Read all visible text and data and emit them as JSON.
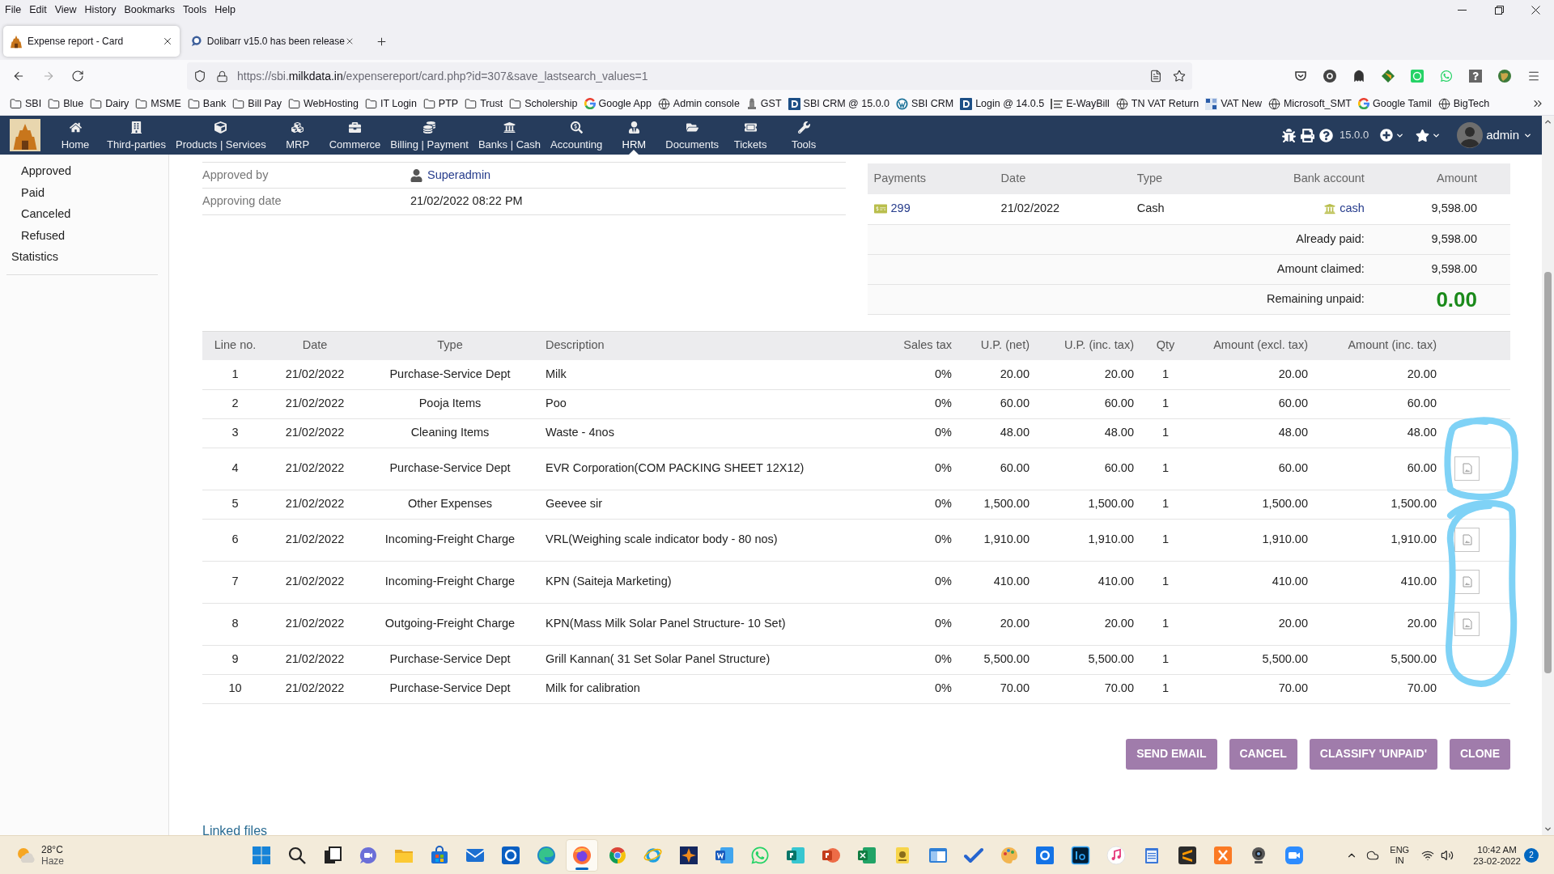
{
  "menubar": [
    "File",
    "Edit",
    "View",
    "History",
    "Bookmarks",
    "Tools",
    "Help"
  ],
  "tabs": [
    {
      "title": "Expense report - Card",
      "selected": true
    },
    {
      "title": "Dolibarr v15.0 has been release",
      "selected": false
    }
  ],
  "address_bar": {
    "url_start": "https://sbi.",
    "url_domain": "milkdata.in",
    "url_rest": "/expensereport/card.php?id=307&save_lastsearch_values=1"
  },
  "bookmarks": [
    {
      "label": "SBI",
      "kind": "folder"
    },
    {
      "label": "Blue",
      "kind": "folder"
    },
    {
      "label": "Dairy",
      "kind": "folder"
    },
    {
      "label": "MSME",
      "kind": "folder"
    },
    {
      "label": "Bank",
      "kind": "folder"
    },
    {
      "label": "Bill Pay",
      "kind": "folder"
    },
    {
      "label": "WebHosting",
      "kind": "folder"
    },
    {
      "label": "IT Login",
      "kind": "folder"
    },
    {
      "label": "PTP",
      "kind": "folder"
    },
    {
      "label": "Trust",
      "kind": "folder"
    },
    {
      "label": "Scholership",
      "kind": "folder"
    },
    {
      "label": "Google App",
      "kind": "google"
    },
    {
      "label": "Admin console",
      "kind": "globe"
    },
    {
      "label": "GST",
      "kind": "emblem"
    },
    {
      "label": "SBI CRM @ 15.0.0",
      "kind": "dolibarr"
    },
    {
      "label": "SBI CRM",
      "kind": "wordpress"
    },
    {
      "label": "Login @ 14.0.5",
      "kind": "dolibarr"
    },
    {
      "label": "E-WayBill",
      "kind": "lines"
    },
    {
      "label": "TN VAT Return",
      "kind": "globe"
    },
    {
      "label": "VAT New",
      "kind": "tile"
    },
    {
      "label": "Microsoft_SMT",
      "kind": "globe"
    },
    {
      "label": "Google Tamil",
      "kind": "google"
    },
    {
      "label": "BigTech",
      "kind": "globe"
    }
  ],
  "top_menu": {
    "items": [
      {
        "label": "Home",
        "kind": "home",
        "selected": false
      },
      {
        "label": "Third-parties",
        "kind": "companies",
        "selected": false
      },
      {
        "label": "Products | Services",
        "kind": "products",
        "selected": false
      },
      {
        "label": "MRP",
        "kind": "mrp",
        "selected": false
      },
      {
        "label": "Commerce",
        "kind": "commerce",
        "selected": false
      },
      {
        "label": "Billing | Payment",
        "kind": "billing",
        "selected": false
      },
      {
        "label": "Banks | Cash",
        "kind": "bank",
        "selected": false
      },
      {
        "label": "Accounting",
        "kind": "accounting",
        "selected": false
      },
      {
        "label": "HRM",
        "kind": "hrm",
        "selected": true
      },
      {
        "label": "Documents",
        "kind": "documents",
        "selected": false
      },
      {
        "label": "Tickets",
        "kind": "tickets",
        "selected": false
      },
      {
        "label": "Tools",
        "kind": "tools",
        "selected": false
      }
    ],
    "version": "15.0.0",
    "user": "admin"
  },
  "sidebar": {
    "status_filters": [
      "Approved",
      "Paid",
      "Canceled",
      "Refused"
    ],
    "statistics": "Statistics"
  },
  "approval": [
    {
      "label": "Approved by",
      "value": "Superadmin",
      "kind": "user"
    },
    {
      "label": "Approving date",
      "value": "21/02/2022 08:22 PM",
      "kind": "text"
    }
  ],
  "payments": {
    "columns": [
      "Payments",
      "Date",
      "Type",
      "Bank account",
      "Amount"
    ],
    "rows": [
      {
        "ref": "299",
        "date": "21/02/2022",
        "type": "Cash",
        "bank_account": "cash",
        "amount": "9,598.00"
      }
    ],
    "totals": [
      {
        "label": "Already paid:",
        "value": "9,598.00",
        "kind": "normal"
      },
      {
        "label": "Amount claimed:",
        "value": "9,598.00",
        "kind": "normal"
      },
      {
        "label": "Remaining unpaid:",
        "value": "0.00",
        "kind": "remaining"
      }
    ]
  },
  "lines": {
    "columns": [
      "Line no.",
      "Date",
      "Type",
      "Description",
      "Sales tax",
      "U.P. (net)",
      "U.P. (inc. tax)",
      "Qty",
      "Amount (excl. tax)",
      "Amount (inc. tax)"
    ],
    "rows": [
      {
        "line_no": "1",
        "date": "21/02/2022",
        "type": "Purchase-Service Dept",
        "description": "Milk",
        "sales_tax": "0%",
        "up_net": "20.00",
        "up_inc_tax": "20.00",
        "qty": "1",
        "amount_excl_tax": "20.00",
        "amount_inc_tax": "20.00",
        "attachment": false
      },
      {
        "line_no": "2",
        "date": "21/02/2022",
        "type": "Pooja Items",
        "description": "Poo",
        "sales_tax": "0%",
        "up_net": "60.00",
        "up_inc_tax": "60.00",
        "qty": "1",
        "amount_excl_tax": "60.00",
        "amount_inc_tax": "60.00",
        "attachment": false
      },
      {
        "line_no": "3",
        "date": "21/02/2022",
        "type": "Cleaning Items",
        "description": "Waste - 4nos",
        "sales_tax": "0%",
        "up_net": "48.00",
        "up_inc_tax": "48.00",
        "qty": "1",
        "amount_excl_tax": "48.00",
        "amount_inc_tax": "48.00",
        "attachment": false
      },
      {
        "line_no": "4",
        "date": "21/02/2022",
        "type": "Purchase-Service Dept",
        "description": "EVR Corporation(COM PACKING SHEET 12X12)",
        "sales_tax": "0%",
        "up_net": "60.00",
        "up_inc_tax": "60.00",
        "qty": "1",
        "amount_excl_tax": "60.00",
        "amount_inc_tax": "60.00",
        "attachment": true
      },
      {
        "line_no": "5",
        "date": "21/02/2022",
        "type": "Other Expenses",
        "description": "Geevee sir",
        "sales_tax": "0%",
        "up_net": "1,500.00",
        "up_inc_tax": "1,500.00",
        "qty": "1",
        "amount_excl_tax": "1,500.00",
        "amount_inc_tax": "1,500.00",
        "attachment": false
      },
      {
        "line_no": "6",
        "date": "21/02/2022",
        "type": "Incoming-Freight Charge",
        "description": "VRL(Weighing scale indicator body - 80 nos)",
        "sales_tax": "0%",
        "up_net": "1,910.00",
        "up_inc_tax": "1,910.00",
        "qty": "1",
        "amount_excl_tax": "1,910.00",
        "amount_inc_tax": "1,910.00",
        "attachment": true
      },
      {
        "line_no": "7",
        "date": "21/02/2022",
        "type": "Incoming-Freight Charge",
        "description": "KPN (Saiteja Marketing)",
        "sales_tax": "0%",
        "up_net": "410.00",
        "up_inc_tax": "410.00",
        "qty": "1",
        "amount_excl_tax": "410.00",
        "amount_inc_tax": "410.00",
        "attachment": true
      },
      {
        "line_no": "8",
        "date": "21/02/2022",
        "type": "Outgoing-Freight Charge",
        "description": "KPN(Mass Milk Solar Panel Structure- 10 Set)",
        "sales_tax": "0%",
        "up_net": "20.00",
        "up_inc_tax": "20.00",
        "qty": "1",
        "amount_excl_tax": "20.00",
        "amount_inc_tax": "20.00",
        "attachment": true
      },
      {
        "line_no": "9",
        "date": "21/02/2022",
        "type": "Purchase-Service Dept",
        "description": "Grill Kannan( 31 Set Solar Panel Structure)",
        "sales_tax": "0%",
        "up_net": "5,500.00",
        "up_inc_tax": "5,500.00",
        "qty": "1",
        "amount_excl_tax": "5,500.00",
        "amount_inc_tax": "5,500.00",
        "attachment": false
      },
      {
        "line_no": "10",
        "date": "21/02/2022",
        "type": "Purchase-Service Dept",
        "description": "Milk for calibration",
        "sales_tax": "0%",
        "up_net": "70.00",
        "up_inc_tax": "70.00",
        "qty": "1",
        "amount_excl_tax": "70.00",
        "amount_inc_tax": "70.00",
        "attachment": false
      }
    ]
  },
  "buttons": [
    "SEND EMAIL",
    "CANCEL",
    "CLASSIFY 'UNPAID'",
    "CLONE"
  ],
  "linked_files": "Linked files",
  "taskbar": {
    "weather": {
      "temperature": "28°C",
      "condition": "Haze"
    },
    "apps": [
      {
        "kind": "start",
        "selected": false
      },
      {
        "kind": "search",
        "selected": false
      },
      {
        "kind": "taskview",
        "selected": false
      },
      {
        "kind": "chat",
        "selected": false
      },
      {
        "kind": "explorer",
        "selected": false
      },
      {
        "kind": "store",
        "selected": false
      },
      {
        "kind": "mail",
        "selected": false
      },
      {
        "kind": "ringtile",
        "selected": false
      },
      {
        "kind": "edge",
        "selected": false
      },
      {
        "kind": "firefox",
        "selected": true
      },
      {
        "kind": "chrome",
        "selected": false
      },
      {
        "kind": "orbit",
        "selected": false
      },
      {
        "kind": "startile",
        "selected": false
      },
      {
        "kind": "word",
        "selected": false
      },
      {
        "kind": "whatsapp",
        "selected": false
      },
      {
        "kind": "publisher",
        "selected": false
      },
      {
        "kind": "slides",
        "selected": false
      },
      {
        "kind": "sheet",
        "selected": false
      },
      {
        "kind": "note",
        "selected": false
      },
      {
        "kind": "windowtile",
        "selected": false
      },
      {
        "kind": "todo",
        "selected": false
      },
      {
        "kind": "palette",
        "selected": false
      },
      {
        "kind": "circletile",
        "selected": false
      },
      {
        "kind": "darktile",
        "selected": false
      },
      {
        "kind": "music",
        "selected": false
      },
      {
        "kind": "notepad",
        "selected": false
      },
      {
        "kind": "stripes",
        "selected": false
      },
      {
        "kind": "cross",
        "selected": false
      },
      {
        "kind": "webcam",
        "selected": false
      },
      {
        "kind": "video",
        "selected": false
      }
    ],
    "language": "ENG",
    "region": "IN",
    "time": "10:42 AM",
    "date": "23-02-2022",
    "notifications": "2"
  }
}
